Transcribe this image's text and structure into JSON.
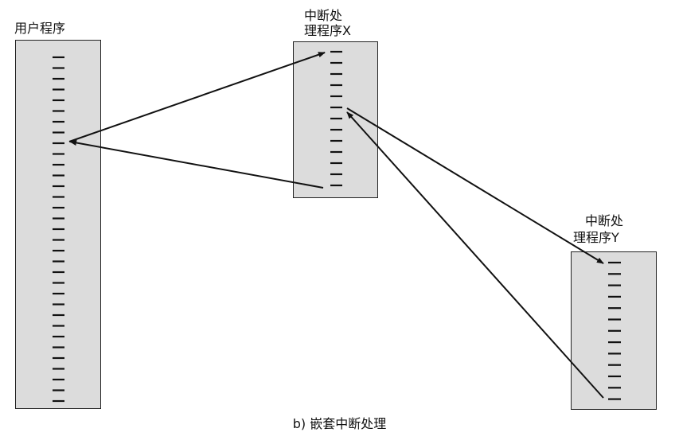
{
  "labels": {
    "user_program": "用户程序",
    "handler_x_line1": "中断处",
    "handler_x_line2": "理程序X",
    "handler_y_line1": "中断处",
    "handler_y_line2": "理程序Y"
  },
  "caption": "b) 嵌套中断处理"
}
